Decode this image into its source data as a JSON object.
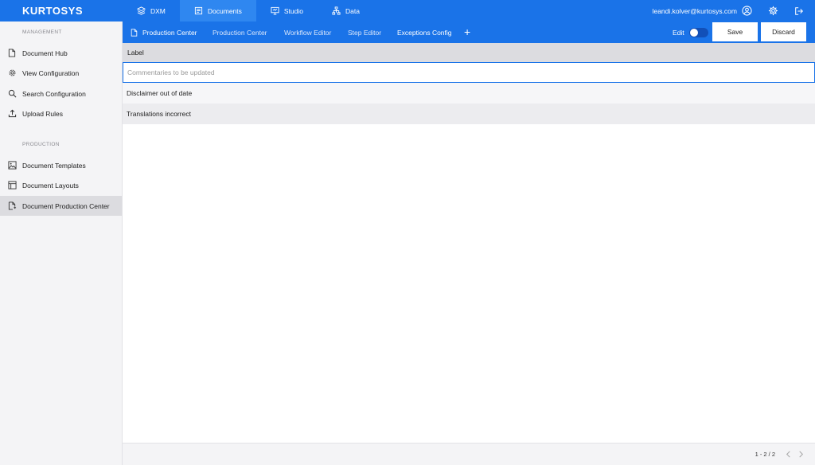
{
  "app": {
    "logo": "KURTOSYS"
  },
  "topnav": [
    {
      "label": "DXM",
      "icon": "layers-icon"
    },
    {
      "label": "Documents",
      "icon": "documents-icon",
      "active": true
    },
    {
      "label": "Studio",
      "icon": "studio-icon"
    },
    {
      "label": "Data",
      "icon": "hierarchy-icon"
    }
  ],
  "user": {
    "email": "leandi.kolver@kurtosys.com"
  },
  "sidebar": {
    "management_header": "MANAGEMENT",
    "management_items": [
      {
        "label": "Document Hub",
        "icon": "document-icon"
      },
      {
        "label": "View Configuration",
        "icon": "gear-icon"
      },
      {
        "label": "Search Configuration",
        "icon": "search-icon"
      },
      {
        "label": "Upload Rules",
        "icon": "upload-icon"
      }
    ],
    "production_header": "PRODUCTION",
    "production_items": [
      {
        "label": "Document Templates",
        "icon": "image-icon"
      },
      {
        "label": "Document Layouts",
        "icon": "layout-icon"
      },
      {
        "label": "Document Production Center",
        "icon": "document-production-icon",
        "active": true
      }
    ]
  },
  "subbar": {
    "tabs": [
      {
        "label": "Production Center",
        "icon": "document-icon"
      },
      {
        "label": "Production Center"
      },
      {
        "label": "Workflow Editor"
      },
      {
        "label": "Step Editor"
      },
      {
        "label": "Exceptions Config"
      }
    ],
    "add_label": "+",
    "edit_label": "Edit",
    "edit_on": false,
    "save_label": "Save",
    "discard_label": "Discard"
  },
  "table": {
    "header": "Label",
    "editing_placeholder": "Commentaries to be updated",
    "rows": [
      {
        "label": "Disclaimer out of date"
      },
      {
        "label": "Translations incorrect"
      }
    ]
  },
  "pager": {
    "text": "1 - 2 / 2"
  },
  "colors": {
    "accent": "#1a73e8",
    "sidebar_bg": "#f4f4f6"
  }
}
